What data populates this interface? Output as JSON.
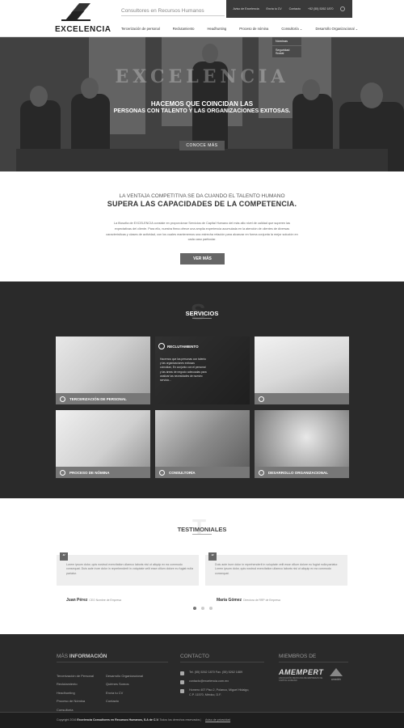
{
  "header": {
    "logo_text": "EXCELENCIA",
    "tagline": "Consultores en Recursos Humanos",
    "topbar": [
      "Aviso de Excelencia",
      "Envía tu CV",
      "Contacto",
      "+52 (55) 5262 1870"
    ],
    "nav": [
      "Tercerización de personal",
      "Reclutamiento",
      "Headhunting",
      "Proceso de nómina",
      "Consultoría ⌄",
      "Desarrollo Organizacional ⌄"
    ],
    "dropdown": [
      "Nóminas",
      "Seguridad Social"
    ]
  },
  "hero": {
    "bigword": "EXCELENCIA",
    "line1": "HACEMOS QUE COINCIDAN LAS",
    "line2": "PERSONAS CON TALENTO Y LAS ORGANIZACIONES EXITOSAS.",
    "button": "CONOCE MÁS"
  },
  "intro": {
    "small": "LA VENTAJA COMPETITIVA SE DA CUANDO EL TALENTO HUMANO",
    "big": "SUPERA LAS CAPACIDADES DE LA COMPETENCIA.",
    "paragraph": "La filosofía de EXCELENCIA consiste en proporcionar Servicios de Capital Humano del más alto nivel de calidad que superen las expectativas del cliente. Para ello, nuestra firma ofrece una amplia experiencia acumulada en la atención de clientes de diversas características y clases de actividad, con los cuales mantenemos una estrecha relación para alcanzar en forma conjunta la mejor solución en cada caso particular.",
    "button": "VER MÁS"
  },
  "services": {
    "title": "SERVICIOS",
    "ghost": "S",
    "tiles": [
      {
        "label": "TERCERIZACIÓN DE PERSONAL"
      },
      {
        "label": "RECLUTAMIENTO",
        "description": "Hacemos que las personas con talento y las organizaciones exitosas coincidan, En conjunto con el personal y las áreas de negocio adecuadas para analizar las necesidades de nuestro servicio..."
      },
      {
        "label": ""
      },
      {
        "label": "PROCESO DE NÓMINA"
      },
      {
        "label": "CONSULTORÍA"
      },
      {
        "label": "DESARROLLO ORGANIZACIONAL"
      }
    ]
  },
  "testimonials": {
    "title": "TESTIMONIALES",
    "ghost": "T",
    "items": [
      {
        "quote": "Lorem ipsum dolor, quis nostrud exercitation ullamco laboris nisi ut aliquip ex ea commodo consequat. Duis aute irure dolor in reprehenderit in voluptate velit esse cillum dolore eu fugiat nulla pariatur.",
        "author": "Juan Pérez",
        "role": "CEO Nombre de Empresa"
      },
      {
        "quote": "Duis aute irure dolor in reprehenderit in voluptate velit esse cillum dolore eu fugiat nulla pariatur. Lorem ipsum dolor, quis nostrud exercitation ullamco laboris nisi ut aliquip ex ea commodo consequat.",
        "author": "María Gómez",
        "role": "Directora de RRP de Empresa"
      }
    ]
  },
  "footer": {
    "info_light": "MÁS",
    "info_bold": "INFORMACIÓN",
    "col1": [
      "Tercerización de Personal",
      "Reclutamiento",
      "Headhunting",
      "Proceso de Nómina",
      "Consultoría"
    ],
    "col2": [
      "Desarrollo Organizacional",
      "Quiénes Somos",
      "Envía tu CV",
      "Contacto"
    ],
    "contact_title": "CONTACTO",
    "phone": "Tel. (55) 5262 1870     Fax. (55) 5262 1889",
    "email": "contacto@excelencia.com.mx",
    "address": "Homero 407 Piso 2, Polanco, Miguel Hidalgo, C.P. 11570, México, D.F.",
    "members_title": "MIEMBROS DE",
    "amempert": "AMEMPERT",
    "amempert_sub": "ASOCIACIÓN MEXICANA DE EMPRESAS DE CAPITAL HUMANO",
    "amedirh": "amedirh",
    "copyright_pre": "Copyright 2016",
    "copyright_bold": "Excelencia Consultores en Recursos Humanos, S.A de C.V.",
    "copyright_post": "Todos los derechos reservados",
    "privacy": "Aviso de privacidad"
  }
}
